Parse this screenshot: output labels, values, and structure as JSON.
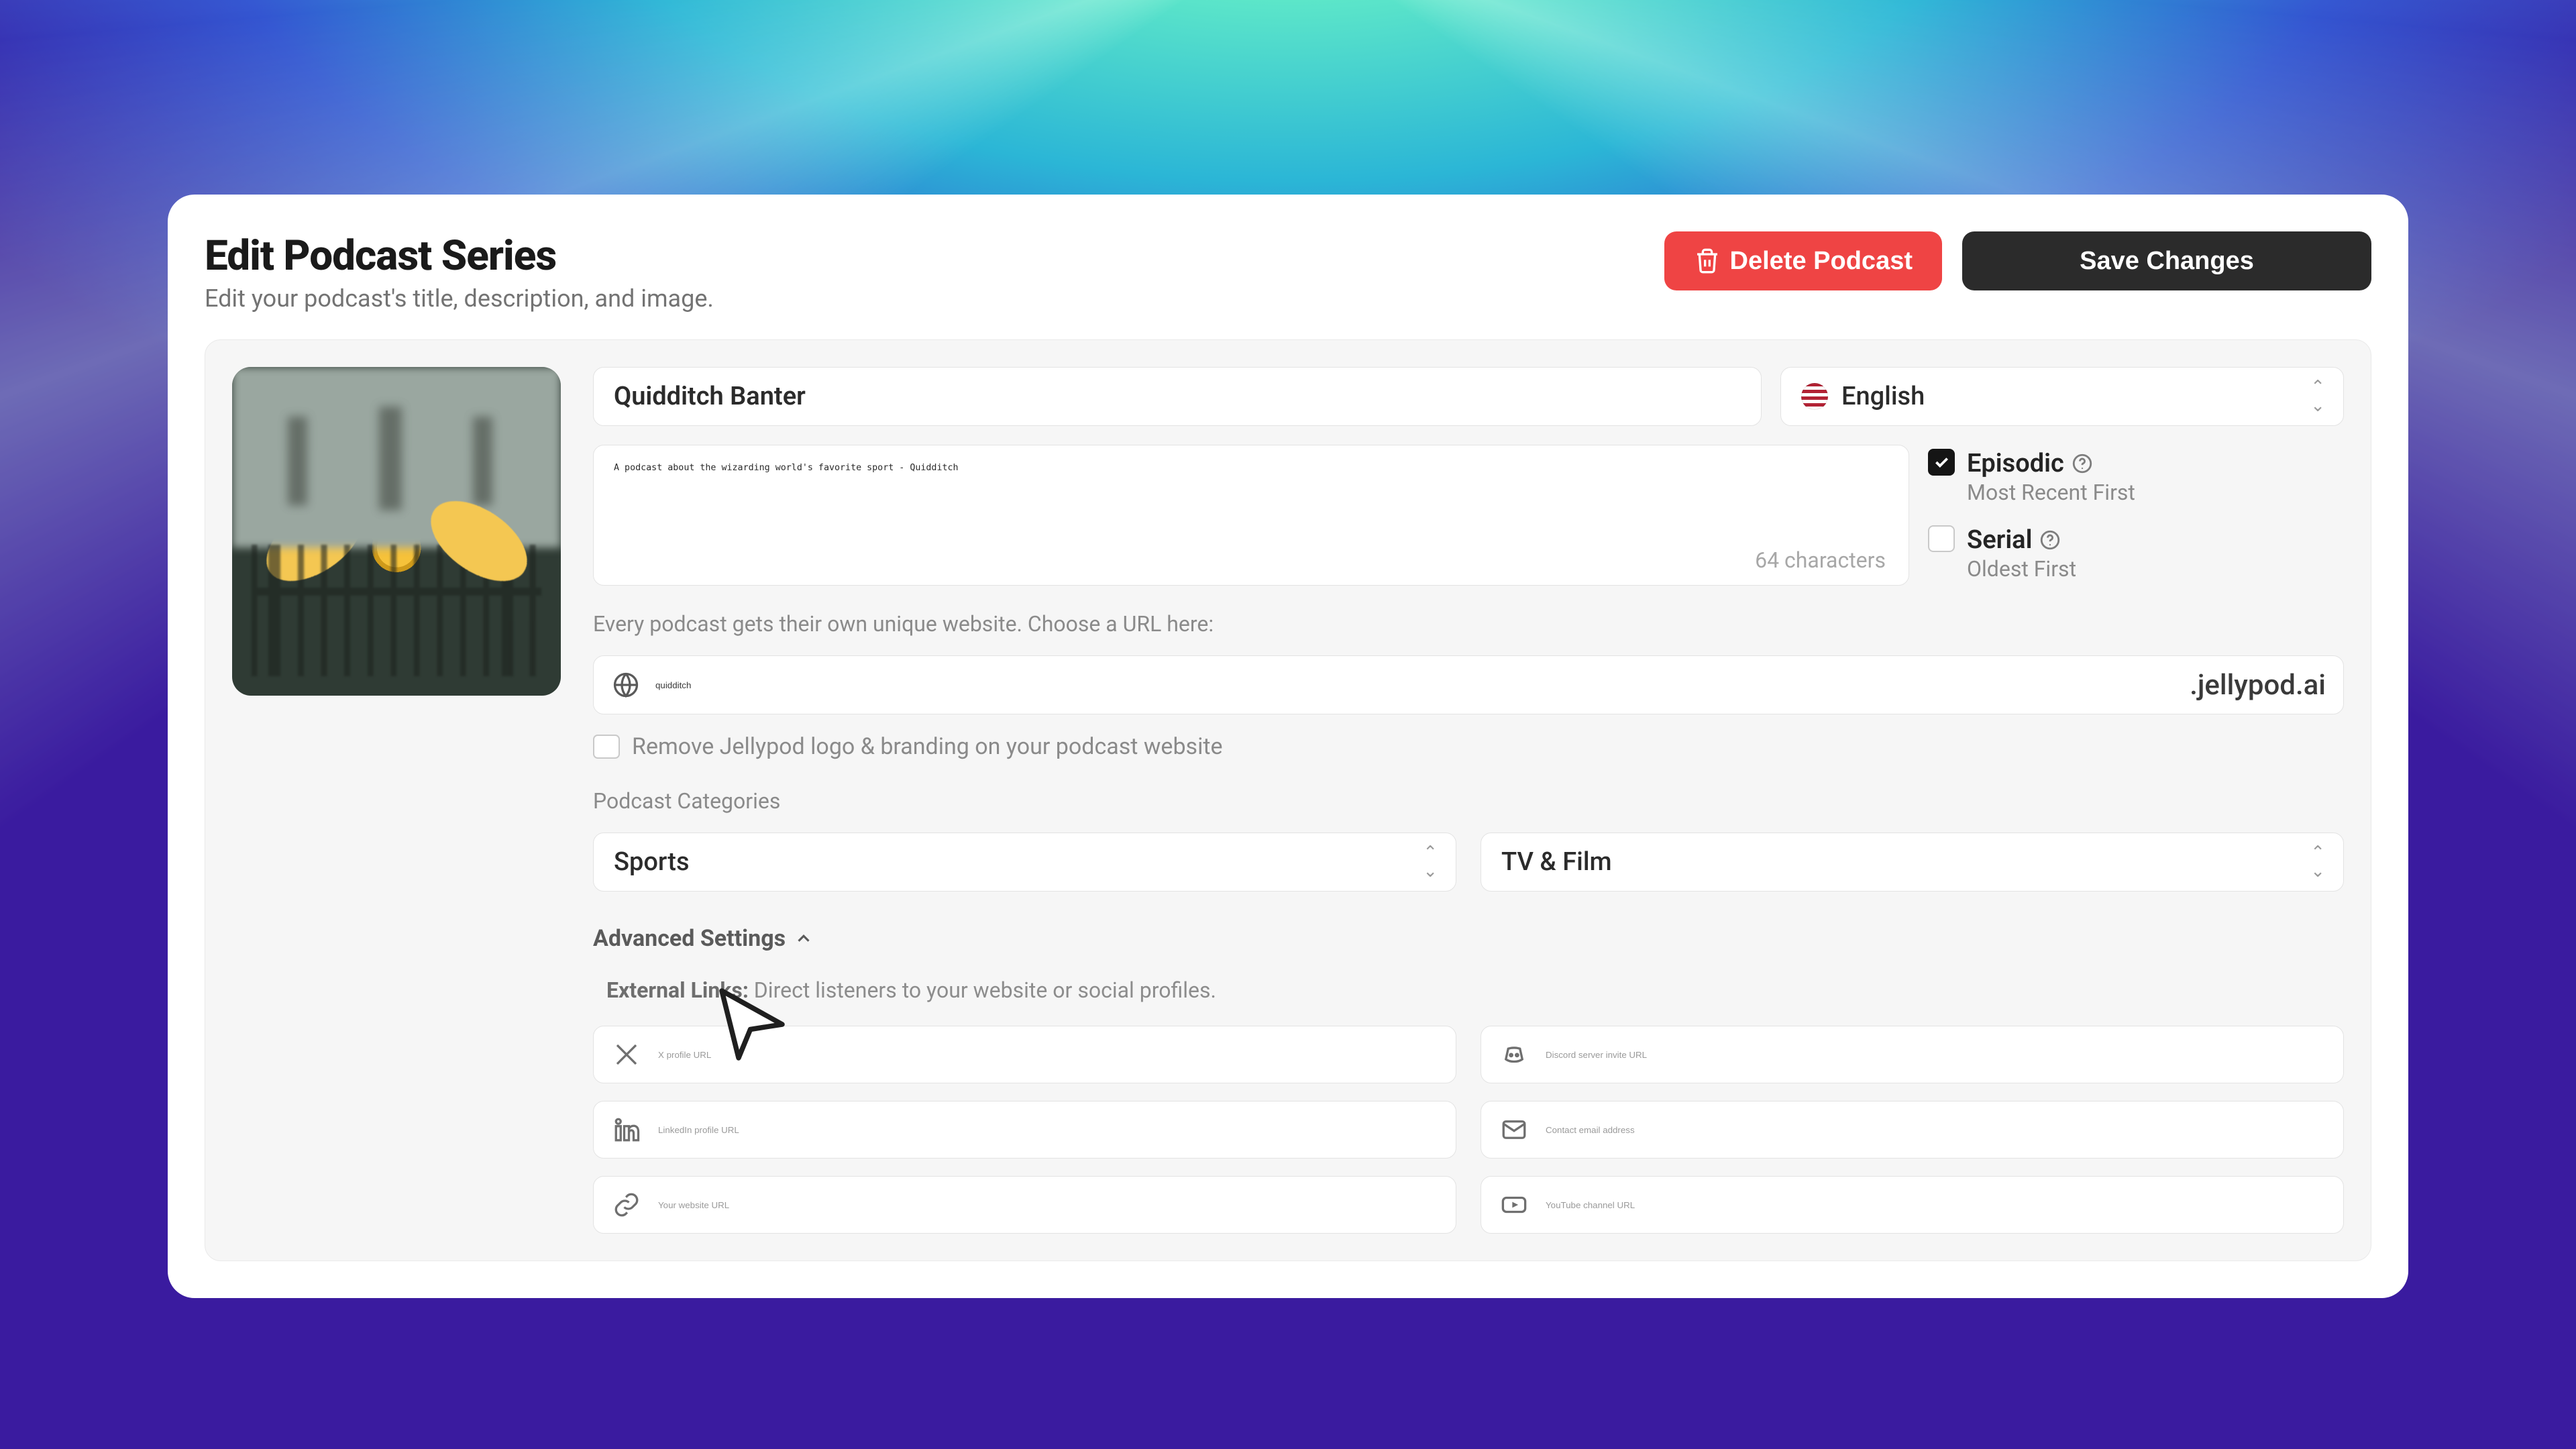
{
  "header": {
    "title": "Edit Podcast Series",
    "subtitle": "Edit your podcast's title, description, and image.",
    "delete_label": "Delete Podcast",
    "save_label": "Save Changes"
  },
  "podcast": {
    "title_value": "Quidditch Banter",
    "language": "English",
    "description_value": "A podcast about the wizarding world's favorite sport - Quidditch",
    "char_count": "64 characters"
  },
  "ordering": {
    "episodic": {
      "title": "Episodic",
      "sub": "Most Recent First",
      "checked": true
    },
    "serial": {
      "title": "Serial",
      "sub": "Oldest First",
      "checked": false
    }
  },
  "website": {
    "hint": "Every podcast gets their own unique website. Choose a URL here:",
    "slug_value": "quidditch",
    "suffix": ".jellypod.ai",
    "remove_branding_label": "Remove Jellypod logo & branding on your podcast website"
  },
  "categories": {
    "label": "Podcast Categories",
    "primary": "Sports",
    "secondary": "TV & Film"
  },
  "advanced": {
    "header": "Advanced Settings",
    "external_label_prefix": "External Links:",
    "external_label_rest": " Direct listeners to your website or social profiles.",
    "links": {
      "x_placeholder": "X profile URL",
      "discord_placeholder": "Discord server invite URL",
      "linkedin_placeholder": "LinkedIn profile URL",
      "contact_placeholder": "Contact email address",
      "website_placeholder": "Your website URL",
      "youtube_placeholder": "YouTube channel URL"
    }
  }
}
